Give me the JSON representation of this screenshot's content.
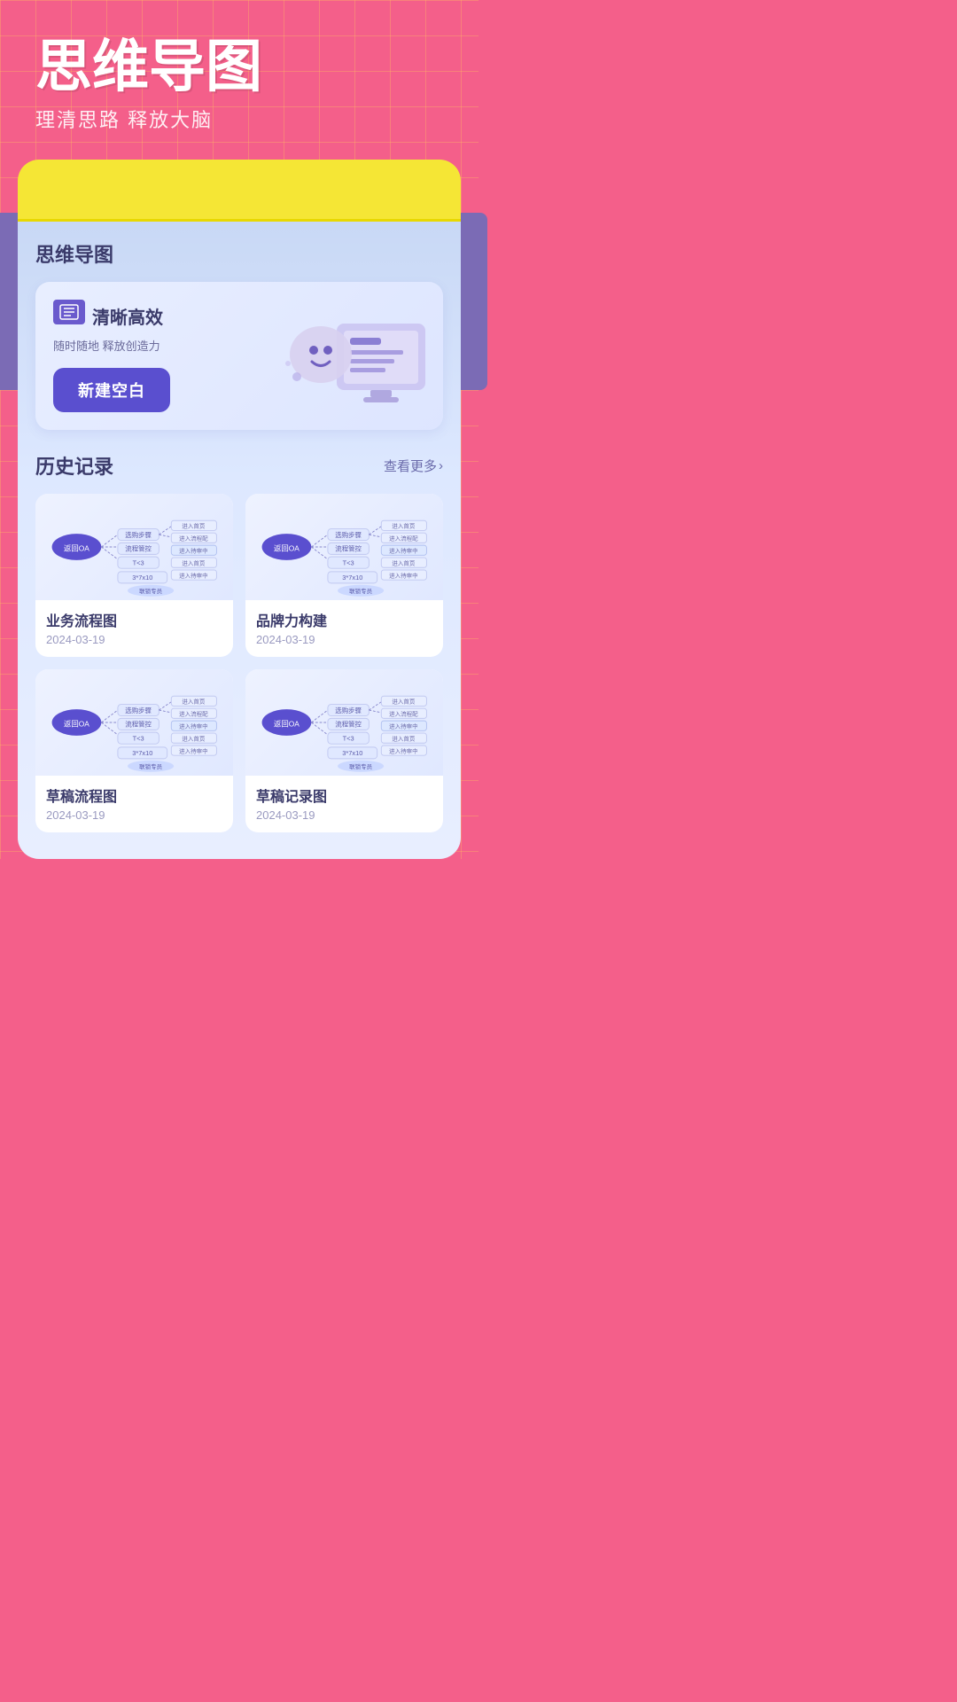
{
  "header": {
    "title": "思维导图",
    "subtitle": "理清思路 释放大脑"
  },
  "card": {
    "section_title": "思维导图",
    "feature": {
      "label": "清晰高效",
      "desc": "随时随地 释放创造力",
      "btn": "新建空白"
    }
  },
  "history": {
    "title": "历史记录",
    "view_more": "查看更多",
    "items": [
      {
        "name": "业务流程图",
        "date": "2024-03-19"
      },
      {
        "name": "品牌力构建",
        "date": "2024-03-19"
      },
      {
        "name": "草稿流程图",
        "date": "2024-03-19"
      },
      {
        "name": "草稿记录图",
        "date": "2024-03-19"
      }
    ]
  },
  "icons": {
    "chevron_right": "›",
    "list_icon": "≡"
  }
}
